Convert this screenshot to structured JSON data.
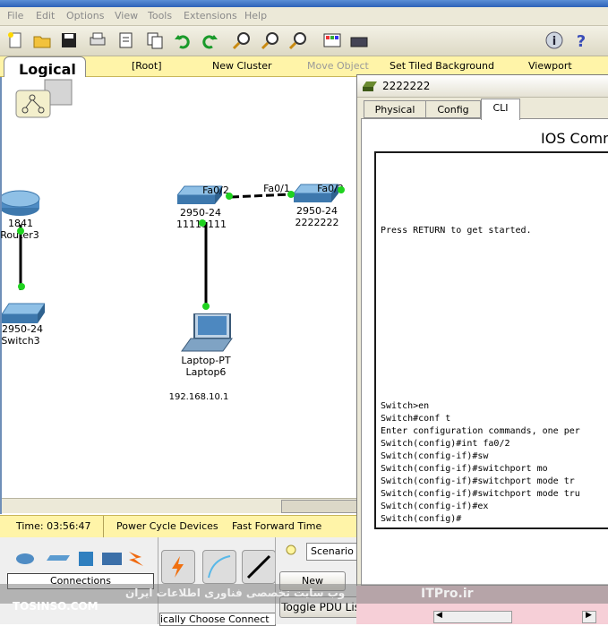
{
  "menu": {
    "file": "File",
    "edit": "Edit",
    "options": "Options",
    "view": "View",
    "tools": "Tools",
    "extensions": "Extensions",
    "help": "Help"
  },
  "logicalbar": {
    "logical": "Logical",
    "root": "[Root]",
    "new_cluster": "New Cluster",
    "move_object": "Move Object",
    "set_tiled_background": "Set Tiled Background",
    "viewport": "Viewport"
  },
  "devices": {
    "router3": {
      "model": "1841",
      "name": "Router3"
    },
    "switch3": {
      "model": "2950-24",
      "name": "Switch3"
    },
    "switch_a": {
      "model": "2950-24",
      "name": "11111111",
      "port": "Fa0/2"
    },
    "switch_b": {
      "model": "2950-24",
      "name": "2222222",
      "port_left": "Fa0/1",
      "port_right": "Fa0/2"
    },
    "laptop6": {
      "model": "Laptop-PT",
      "name": "Laptop6",
      "ip": "192.168.10.1"
    }
  },
  "statusbar": {
    "time": "Time: 03:56:47",
    "power_cycle": "Power Cycle Devices",
    "fast_forward": "Fast Forward Time"
  },
  "bottom": {
    "connections": "Connections",
    "connection_hint": "ically Choose Connect",
    "scenario": "Scenario",
    "new_button": "New",
    "toggle_pdu": "Toggle PDU List Window"
  },
  "cli_window": {
    "title": "2222222",
    "tabs": [
      "Physical",
      "Config",
      "CLI"
    ],
    "active_tab": "CLI",
    "heading": "IOS Comm",
    "lines": [
      "Press RETURN to get started.",
      "Switch>en",
      "Switch#conf t",
      "Enter configuration commands, one per",
      "Switch(config)#int fa0/2",
      "Switch(config-if)#sw",
      "Switch(config-if)#switchport mo",
      "Switch(config-if)#switchport mode tr",
      "Switch(config-if)#switchport mode tru",
      "Switch(config-if)#ex",
      "Switch(config)#"
    ]
  },
  "watermark": {
    "persian": "وب سایت تخصصی فناوری اطلاعات ایران",
    "site": "ITPro.ir",
    "tosinso": "TOSINSO.COM"
  },
  "colors": {
    "link_dot": "#1fd21f",
    "logical_bar": "#fff4a8",
    "chrome": "#ece9d8"
  }
}
